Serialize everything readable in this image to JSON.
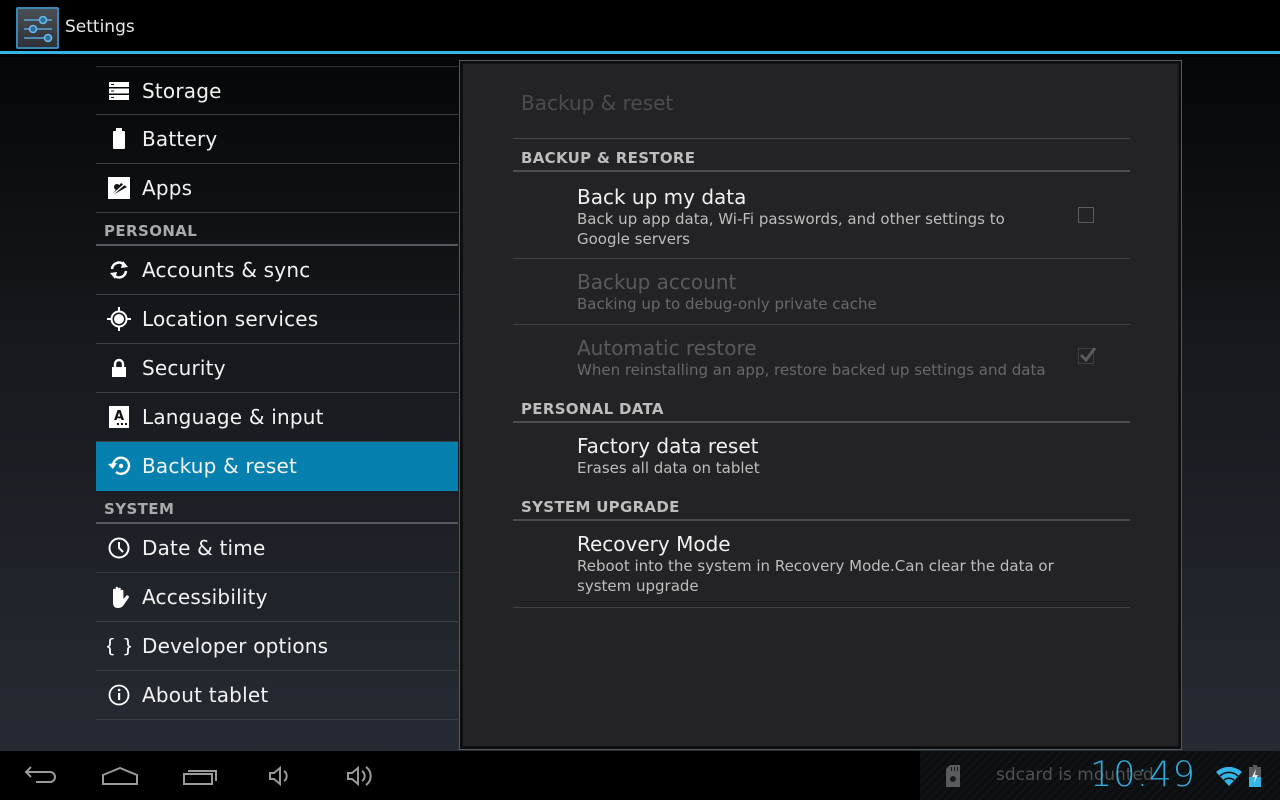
{
  "app": {
    "title": "Settings",
    "icon": "settings-sliders-icon",
    "accent_color": "#33b5e5",
    "selected_color": "#0681af"
  },
  "sidebar": {
    "items_top": [
      {
        "label": "Storage",
        "icon": "storage-icon"
      },
      {
        "label": "Battery",
        "icon": "battery-icon"
      },
      {
        "label": "Apps",
        "icon": "apps-icon"
      }
    ],
    "personal_header": "PERSONAL",
    "items_personal": [
      {
        "label": "Accounts & sync",
        "icon": "sync-icon"
      },
      {
        "label": "Location services",
        "icon": "location-icon"
      },
      {
        "label": "Security",
        "icon": "lock-icon"
      },
      {
        "label": "Language & input",
        "icon": "language-icon"
      },
      {
        "label": "Backup & reset",
        "icon": "backup-icon",
        "selected": true
      }
    ],
    "system_header": "SYSTEM",
    "items_system": [
      {
        "label": "Date & time",
        "icon": "clock-icon"
      },
      {
        "label": "Accessibility",
        "icon": "hand-icon"
      },
      {
        "label": "Developer options",
        "icon": "braces-icon"
      },
      {
        "label": "About tablet",
        "icon": "info-icon"
      }
    ]
  },
  "panel": {
    "title": "Backup & reset",
    "categories": [
      {
        "title": "BACKUP & RESTORE",
        "prefs": [
          {
            "title": "Back up my data",
            "summary": "Back up app data, Wi-Fi passwords, and other settings to Google servers",
            "checkbox": true,
            "checked": false,
            "enabled": true
          },
          {
            "title": "Backup account",
            "summary": "Backing up to debug-only private cache",
            "checkbox": false,
            "enabled": false
          },
          {
            "title": "Automatic restore",
            "summary": "When reinstalling an app, restore backed up settings and data",
            "checkbox": true,
            "checked": true,
            "enabled": false
          }
        ]
      },
      {
        "title": "PERSONAL DATA",
        "prefs": [
          {
            "title": "Factory data reset",
            "summary": "Erases all data on tablet",
            "checkbox": false,
            "enabled": true
          }
        ]
      },
      {
        "title": "SYSTEM UPGRADE",
        "prefs": [
          {
            "title": "Recovery Mode",
            "summary": "Reboot into the system in Recovery Mode.Can clear the data or system upgrade",
            "checkbox": false,
            "enabled": true
          }
        ]
      }
    ]
  },
  "navbar": {
    "buttons": [
      "back-icon",
      "home-icon",
      "recent-apps-icon",
      "volume-down-icon",
      "volume-up-icon"
    ]
  },
  "status": {
    "notification_icon": "sdcard-icon",
    "notification_text": "sdcard is mounted",
    "time": "10:49",
    "wifi": "wifi-icon",
    "battery": "battery-charging-icon"
  }
}
